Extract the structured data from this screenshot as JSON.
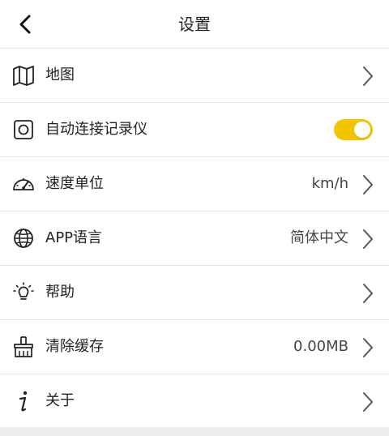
{
  "header": {
    "title": "设置"
  },
  "settings": {
    "items": [
      {
        "label": "地图",
        "icon": "map-icon",
        "value": ""
      },
      {
        "label": "自动连接记录仪",
        "icon": "camera-square-icon",
        "toggle_on": true
      },
      {
        "label": "速度单位",
        "icon": "speedometer-icon",
        "value": "km/h"
      },
      {
        "label": "APP语言",
        "icon": "globe-icon",
        "value": "简体中文"
      },
      {
        "label": "帮助",
        "icon": "lightbulb-icon",
        "value": ""
      },
      {
        "label": "清除缓存",
        "icon": "brush-icon",
        "value": "0.00MB"
      },
      {
        "label": "关于",
        "icon": "info-icon",
        "value": ""
      }
    ]
  },
  "colors": {
    "toggle_accent": "#f5c400",
    "divider": "#e4e4e4",
    "footer_band": "#eeeeee"
  }
}
